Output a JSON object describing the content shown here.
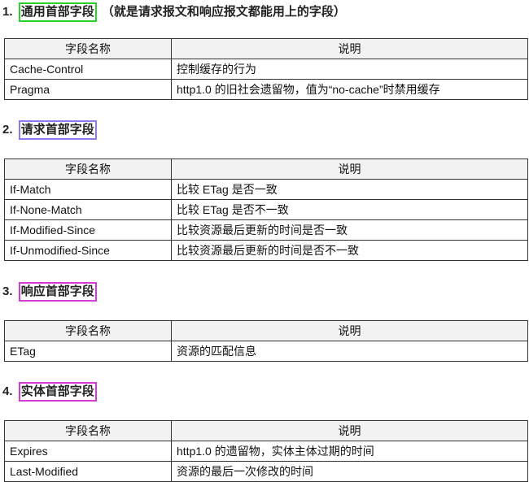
{
  "sections": [
    {
      "number": "1.",
      "title": "通用首部字段",
      "suffix": "（就是请求报文和响应报文都能用上的字段）",
      "headers": [
        "字段名称",
        "说明"
      ],
      "rows": [
        [
          "Cache-Control",
          "控制缓存的行为"
        ],
        [
          "Pragma",
          "http1.0 的旧社会遗留物，值为“no-cache”时禁用缓存"
        ]
      ]
    },
    {
      "number": "2.",
      "title": "请求首部字段",
      "headers": [
        "字段名称",
        "说明"
      ],
      "rows": [
        [
          "If-Match",
          "比较 ETag 是否一致"
        ],
        [
          "If-None-Match",
          "比较 ETag 是否不一致"
        ],
        [
          "If-Modified-Since",
          "比较资源最后更新的时间是否一致"
        ],
        [
          "If-Unmodified-Since",
          "比较资源最后更新的时间是否不一致"
        ]
      ]
    },
    {
      "number": "3.",
      "title": "响应首部字段",
      "headers": [
        "字段名称",
        "说明"
      ],
      "rows": [
        [
          "ETag",
          "资源的匹配信息"
        ]
      ]
    },
    {
      "number": "4.",
      "title": "实体首部字段",
      "headers": [
        "字段名称",
        "说明"
      ],
      "rows": [
        [
          "Expires",
          "http1.0 的遗留物，实体主体过期的时间"
        ],
        [
          "Last-Modified",
          "资源的最后一次修改的时间"
        ]
      ]
    }
  ],
  "colors": {
    "section1_box": "#2bd12b",
    "section2_box": "#8a7cf0",
    "section3_box": "#d43ad4",
    "section4_box": "#d43ad4",
    "header_bg": "#f2f2f2"
  }
}
